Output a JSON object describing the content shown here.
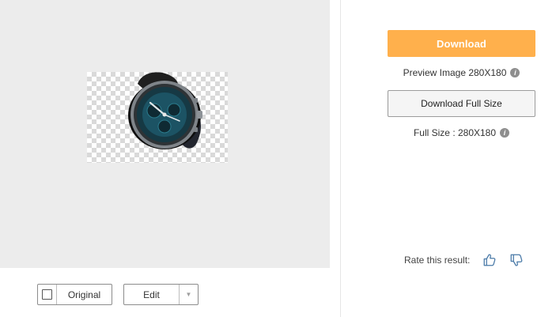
{
  "left": {
    "compare_label": "Original",
    "edit_label": "Edit",
    "edit_dropdown_icon": "caret-down-icon"
  },
  "right": {
    "download_label": "Download",
    "preview_text": "Preview Image 280X180",
    "download_full_label": "Download Full Size",
    "full_size_text": "Full Size : 280X180",
    "rate_label": "Rate this result:"
  },
  "icons": {
    "info": "info-icon",
    "thumbs_up": "thumbs-up-icon",
    "thumbs_down": "thumbs-down-icon"
  },
  "colors": {
    "accent": "#ffb04c",
    "panel_bg": "#ececec",
    "checker": "#d9d9d9"
  }
}
